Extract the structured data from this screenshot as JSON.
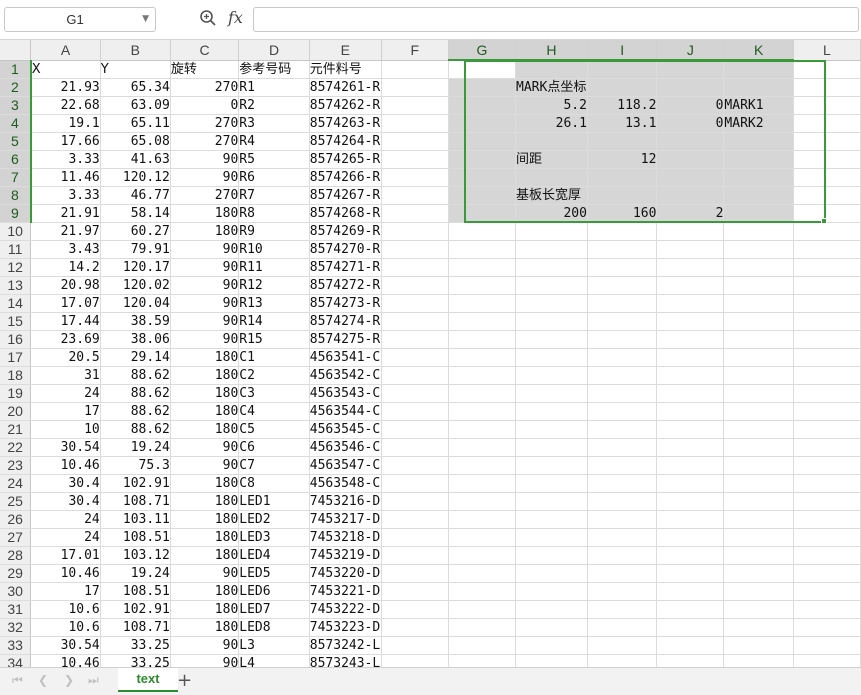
{
  "formula_bar": {
    "name_box": "G1",
    "fx_label": "fx",
    "formula": ""
  },
  "columns": [
    "A",
    "B",
    "C",
    "D",
    "E",
    "F",
    "G",
    "H",
    "I",
    "J",
    "K",
    "L"
  ],
  "header_row": {
    "A": "X",
    "B": "Y",
    "C": "旋转",
    "D": "参考号码",
    "E": "元件料号"
  },
  "rows": [
    {
      "A": "21.93",
      "B": "65.34",
      "C": "270",
      "D": "R1",
      "E": "8574261-R"
    },
    {
      "A": "22.68",
      "B": "63.09",
      "C": "0",
      "D": "R2",
      "E": "8574262-R"
    },
    {
      "A": "19.1",
      "B": "65.11",
      "C": "270",
      "D": "R3",
      "E": "8574263-R"
    },
    {
      "A": "17.66",
      "B": "65.08",
      "C": "270",
      "D": "R4",
      "E": "8574264-R"
    },
    {
      "A": "3.33",
      "B": "41.63",
      "C": "90",
      "D": "R5",
      "E": "8574265-R"
    },
    {
      "A": "11.46",
      "B": "120.12",
      "C": "90",
      "D": "R6",
      "E": "8574266-R"
    },
    {
      "A": "3.33",
      "B": "46.77",
      "C": "270",
      "D": "R7",
      "E": "8574267-R"
    },
    {
      "A": "21.91",
      "B": "58.14",
      "C": "180",
      "D": "R8",
      "E": "8574268-R"
    },
    {
      "A": "21.97",
      "B": "60.27",
      "C": "180",
      "D": "R9",
      "E": "8574269-R"
    },
    {
      "A": "3.43",
      "B": "79.91",
      "C": "90",
      "D": "R10",
      "E": "8574270-R"
    },
    {
      "A": "14.2",
      "B": "120.17",
      "C": "90",
      "D": "R11",
      "E": "8574271-R"
    },
    {
      "A": "20.98",
      "B": "120.02",
      "C": "90",
      "D": "R12",
      "E": "8574272-R"
    },
    {
      "A": "17.07",
      "B": "120.04",
      "C": "90",
      "D": "R13",
      "E": "8574273-R"
    },
    {
      "A": "17.44",
      "B": "38.59",
      "C": "90",
      "D": "R14",
      "E": "8574274-R"
    },
    {
      "A": "23.69",
      "B": "38.06",
      "C": "90",
      "D": "R15",
      "E": "8574275-R"
    },
    {
      "A": "20.5",
      "B": "29.14",
      "C": "180",
      "D": "C1",
      "E": "4563541-C"
    },
    {
      "A": "31",
      "B": "88.62",
      "C": "180",
      "D": "C2",
      "E": "4563542-C"
    },
    {
      "A": "24",
      "B": "88.62",
      "C": "180",
      "D": "C3",
      "E": "4563543-C"
    },
    {
      "A": "17",
      "B": "88.62",
      "C": "180",
      "D": "C4",
      "E": "4563544-C"
    },
    {
      "A": "10",
      "B": "88.62",
      "C": "180",
      "D": "C5",
      "E": "4563545-C"
    },
    {
      "A": "30.54",
      "B": "19.24",
      "C": "90",
      "D": "C6",
      "E": "4563546-C"
    },
    {
      "A": "10.46",
      "B": "75.3",
      "C": "90",
      "D": "C7",
      "E": "4563547-C"
    },
    {
      "A": "30.4",
      "B": "102.91",
      "C": "180",
      "D": "C8",
      "E": "4563548-C"
    },
    {
      "A": "30.4",
      "B": "108.71",
      "C": "180",
      "D": "LED1",
      "E": "7453216-D"
    },
    {
      "A": "24",
      "B": "103.11",
      "C": "180",
      "D": "LED2",
      "E": "7453217-D"
    },
    {
      "A": "24",
      "B": "108.51",
      "C": "180",
      "D": "LED3",
      "E": "7453218-D"
    },
    {
      "A": "17.01",
      "B": "103.12",
      "C": "180",
      "D": "LED4",
      "E": "7453219-D"
    },
    {
      "A": "10.46",
      "B": "19.24",
      "C": "90",
      "D": "LED5",
      "E": "7453220-D"
    },
    {
      "A": "17",
      "B": "108.51",
      "C": "180",
      "D": "LED6",
      "E": "7453221-D"
    },
    {
      "A": "10.6",
      "B": "102.91",
      "C": "180",
      "D": "LED7",
      "E": "7453222-D"
    },
    {
      "A": "10.6",
      "B": "108.71",
      "C": "180",
      "D": "LED8",
      "E": "7453223-D"
    },
    {
      "A": "30.54",
      "B": "33.25",
      "C": "90",
      "D": "L3",
      "E": "8573242-L"
    },
    {
      "A": "10.46",
      "B": "33.25",
      "C": "90",
      "D": "L4",
      "E": "8573243-L"
    }
  ],
  "side_cells": {
    "H2": "MARK点坐标",
    "H3": "5.2",
    "I3": "118.2",
    "J3": "0",
    "K3": "MARK1",
    "H4": "26.1",
    "I4": "13.1",
    "J4": "0",
    "K4": "MARK2",
    "H6": "间距",
    "I6": "12",
    "H8": "基板长宽厚",
    "H9": "200",
    "I9": "160",
    "J9": "2"
  },
  "sheet_tabs": {
    "active": "text",
    "add_label": "+"
  },
  "colors": {
    "accent": "#3a9a3a",
    "red_text": "#c4241b",
    "selection_fill": "#d6d6d6"
  }
}
